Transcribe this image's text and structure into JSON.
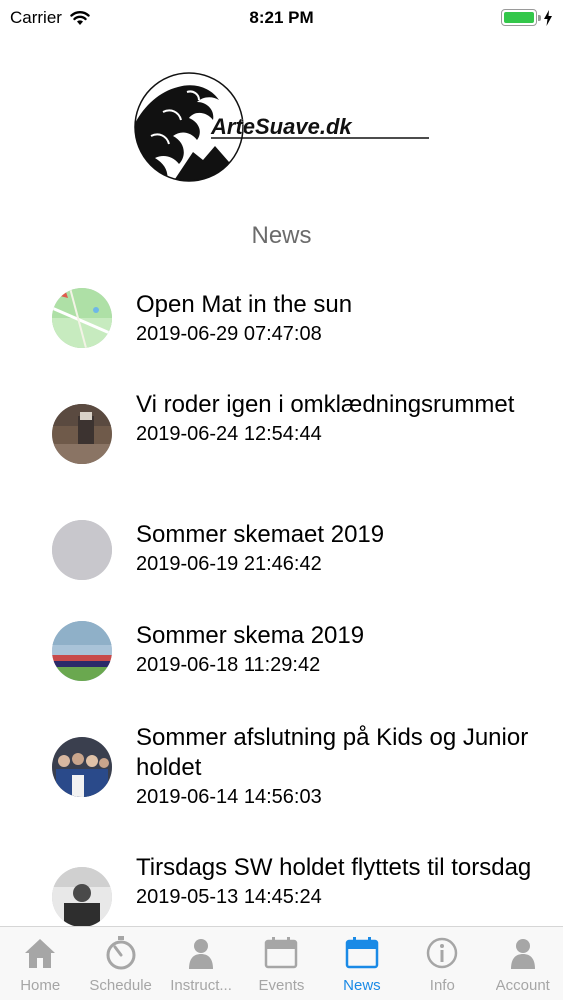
{
  "status_bar": {
    "carrier": "Carrier",
    "time": "8:21 PM",
    "battery_level": 1.0
  },
  "logo": {
    "text": "ArteSuave.dk"
  },
  "page": {
    "title": "News"
  },
  "news": [
    {
      "title": "Open Mat in the sun",
      "date": "2019-06-29 07:47:08",
      "thumbnail": "map-image"
    },
    {
      "title": "Vi roder igen i omklædningsrummet",
      "date": "2019-06-24 12:54:44",
      "thumbnail": "room-photo"
    },
    {
      "title": "Sommer skemaet 2019",
      "date": "2019-06-19 21:46:42",
      "thumbnail": "placeholder"
    },
    {
      "title": "Sommer skema 2019",
      "date": "2019-06-18 11:29:42",
      "thumbnail": "field-photo"
    },
    {
      "title": "Sommer afslutning på Kids og Junior holdet",
      "date": "2019-06-14 14:56:03",
      "thumbnail": "group-photo"
    },
    {
      "title": "Tirsdags SW holdet flyttets til torsdag",
      "date": "2019-05-13 14:45:24",
      "thumbnail": "person-photo"
    }
  ],
  "tab_bar": {
    "active_color": "#1a8ae6",
    "inactive_color": "#a6a6a6",
    "tabs": [
      {
        "label": "Home",
        "icon": "home-icon"
      },
      {
        "label": "Schedule",
        "icon": "stopwatch-icon"
      },
      {
        "label": "Instruct...",
        "icon": "person-icon"
      },
      {
        "label": "Events",
        "icon": "calendar-icon"
      },
      {
        "label": "News",
        "icon": "calendar-icon",
        "active": true
      },
      {
        "label": "Info",
        "icon": "info-icon"
      },
      {
        "label": "Account",
        "icon": "person-icon"
      }
    ]
  }
}
